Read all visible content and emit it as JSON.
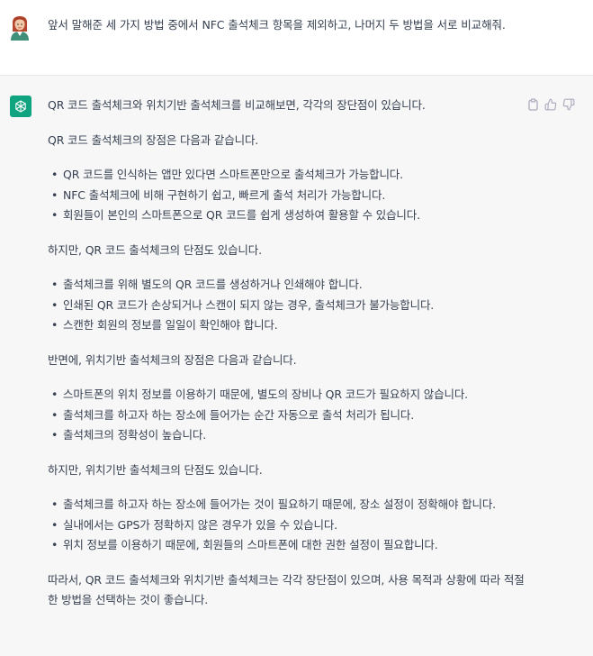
{
  "user_message": {
    "text": "앞서 말해준 세 가지 방법 중에서 NFC 출석체크 항목을 제외하고, 나머지 두 방법을 서로 비교해줘."
  },
  "assistant_message": {
    "intro": "QR 코드 출석체크와 위치기반 출석체크를 비교해보면, 각각의 장단점이 있습니다.",
    "qr_pros_heading": "QR 코드 출석체크의 장점은 다음과 같습니다.",
    "qr_pros": [
      "QR 코드를 인식하는 앱만 있다면 스마트폰만으로 출석체크가 가능합니다.",
      "NFC 출석체크에 비해 구현하기 쉽고, 빠르게 출석 처리가 가능합니다.",
      "회원들이 본인의 스마트폰으로 QR 코드를 쉽게 생성하여 활용할 수 있습니다."
    ],
    "qr_cons_heading": "하지만, QR 코드 출석체크의 단점도 있습니다.",
    "qr_cons": [
      "출석체크를 위해 별도의 QR 코드를 생성하거나 인쇄해야 합니다.",
      "인쇄된 QR 코드가 손상되거나 스캔이 되지 않는 경우, 출석체크가 불가능합니다.",
      "스캔한 회원의 정보를 일일이 확인해야 합니다."
    ],
    "loc_pros_heading": "반면에, 위치기반 출석체크의 장점은 다음과 같습니다.",
    "loc_pros": [
      "스마트폰의 위치 정보를 이용하기 때문에, 별도의 장비나 QR 코드가 필요하지 않습니다.",
      "출석체크를 하고자 하는 장소에 들어가는 순간 자동으로 출석 처리가 됩니다.",
      "출석체크의 정확성이 높습니다."
    ],
    "loc_cons_heading": "하지만, 위치기반 출석체크의 단점도 있습니다.",
    "loc_cons": [
      "출석체크를 하고자 하는 장소에 들어가는 것이 필요하기 때문에, 장소 설정이 정확해야 합니다.",
      "실내에서는 GPS가 정확하지 않은 경우가 있을 수 있습니다.",
      "위치 정보를 이용하기 때문에, 회원들의 스마트폰에 대한 권한 설정이 필요합니다."
    ],
    "conclusion": "따라서, QR 코드 출석체크와 위치기반 출석체크는 각각 장단점이 있으며, 사용 목적과 상황에 따라 적절한 방법을 선택하는 것이 좋습니다."
  },
  "icons": {
    "user_avatar": "user-avatar-icon",
    "assistant_avatar": "openai-logo-icon",
    "copy": "clipboard-icon",
    "like": "thumbs-up-icon",
    "dislike": "thumbs-down-icon"
  },
  "colors": {
    "assistant_bg": "#f7f7f8",
    "assistant_avatar_bg": "#10a37f",
    "text": "#374151",
    "icon": "#acacbe"
  }
}
